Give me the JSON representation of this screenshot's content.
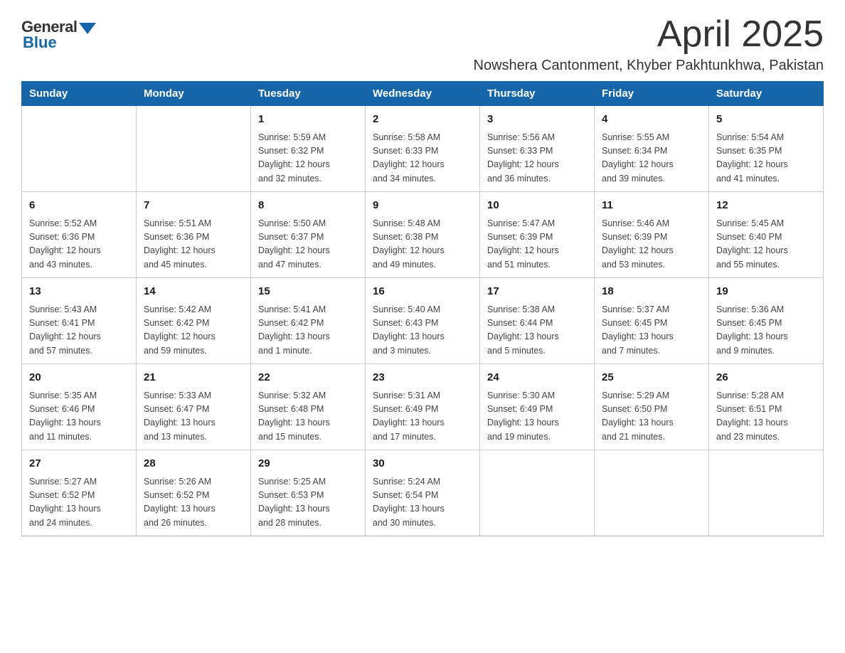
{
  "logo": {
    "general": "General",
    "blue": "Blue"
  },
  "title": "April 2025",
  "location": "Nowshera Cantonment, Khyber Pakhtunkhwa, Pakistan",
  "weekdays": [
    "Sunday",
    "Monday",
    "Tuesday",
    "Wednesday",
    "Thursday",
    "Friday",
    "Saturday"
  ],
  "weeks": [
    [
      {
        "day": "",
        "info": ""
      },
      {
        "day": "",
        "info": ""
      },
      {
        "day": "1",
        "info": "Sunrise: 5:59 AM\nSunset: 6:32 PM\nDaylight: 12 hours\nand 32 minutes."
      },
      {
        "day": "2",
        "info": "Sunrise: 5:58 AM\nSunset: 6:33 PM\nDaylight: 12 hours\nand 34 minutes."
      },
      {
        "day": "3",
        "info": "Sunrise: 5:56 AM\nSunset: 6:33 PM\nDaylight: 12 hours\nand 36 minutes."
      },
      {
        "day": "4",
        "info": "Sunrise: 5:55 AM\nSunset: 6:34 PM\nDaylight: 12 hours\nand 39 minutes."
      },
      {
        "day": "5",
        "info": "Sunrise: 5:54 AM\nSunset: 6:35 PM\nDaylight: 12 hours\nand 41 minutes."
      }
    ],
    [
      {
        "day": "6",
        "info": "Sunrise: 5:52 AM\nSunset: 6:36 PM\nDaylight: 12 hours\nand 43 minutes."
      },
      {
        "day": "7",
        "info": "Sunrise: 5:51 AM\nSunset: 6:36 PM\nDaylight: 12 hours\nand 45 minutes."
      },
      {
        "day": "8",
        "info": "Sunrise: 5:50 AM\nSunset: 6:37 PM\nDaylight: 12 hours\nand 47 minutes."
      },
      {
        "day": "9",
        "info": "Sunrise: 5:48 AM\nSunset: 6:38 PM\nDaylight: 12 hours\nand 49 minutes."
      },
      {
        "day": "10",
        "info": "Sunrise: 5:47 AM\nSunset: 6:39 PM\nDaylight: 12 hours\nand 51 minutes."
      },
      {
        "day": "11",
        "info": "Sunrise: 5:46 AM\nSunset: 6:39 PM\nDaylight: 12 hours\nand 53 minutes."
      },
      {
        "day": "12",
        "info": "Sunrise: 5:45 AM\nSunset: 6:40 PM\nDaylight: 12 hours\nand 55 minutes."
      }
    ],
    [
      {
        "day": "13",
        "info": "Sunrise: 5:43 AM\nSunset: 6:41 PM\nDaylight: 12 hours\nand 57 minutes."
      },
      {
        "day": "14",
        "info": "Sunrise: 5:42 AM\nSunset: 6:42 PM\nDaylight: 12 hours\nand 59 minutes."
      },
      {
        "day": "15",
        "info": "Sunrise: 5:41 AM\nSunset: 6:42 PM\nDaylight: 13 hours\nand 1 minute."
      },
      {
        "day": "16",
        "info": "Sunrise: 5:40 AM\nSunset: 6:43 PM\nDaylight: 13 hours\nand 3 minutes."
      },
      {
        "day": "17",
        "info": "Sunrise: 5:38 AM\nSunset: 6:44 PM\nDaylight: 13 hours\nand 5 minutes."
      },
      {
        "day": "18",
        "info": "Sunrise: 5:37 AM\nSunset: 6:45 PM\nDaylight: 13 hours\nand 7 minutes."
      },
      {
        "day": "19",
        "info": "Sunrise: 5:36 AM\nSunset: 6:45 PM\nDaylight: 13 hours\nand 9 minutes."
      }
    ],
    [
      {
        "day": "20",
        "info": "Sunrise: 5:35 AM\nSunset: 6:46 PM\nDaylight: 13 hours\nand 11 minutes."
      },
      {
        "day": "21",
        "info": "Sunrise: 5:33 AM\nSunset: 6:47 PM\nDaylight: 13 hours\nand 13 minutes."
      },
      {
        "day": "22",
        "info": "Sunrise: 5:32 AM\nSunset: 6:48 PM\nDaylight: 13 hours\nand 15 minutes."
      },
      {
        "day": "23",
        "info": "Sunrise: 5:31 AM\nSunset: 6:49 PM\nDaylight: 13 hours\nand 17 minutes."
      },
      {
        "day": "24",
        "info": "Sunrise: 5:30 AM\nSunset: 6:49 PM\nDaylight: 13 hours\nand 19 minutes."
      },
      {
        "day": "25",
        "info": "Sunrise: 5:29 AM\nSunset: 6:50 PM\nDaylight: 13 hours\nand 21 minutes."
      },
      {
        "day": "26",
        "info": "Sunrise: 5:28 AM\nSunset: 6:51 PM\nDaylight: 13 hours\nand 23 minutes."
      }
    ],
    [
      {
        "day": "27",
        "info": "Sunrise: 5:27 AM\nSunset: 6:52 PM\nDaylight: 13 hours\nand 24 minutes."
      },
      {
        "day": "28",
        "info": "Sunrise: 5:26 AM\nSunset: 6:52 PM\nDaylight: 13 hours\nand 26 minutes."
      },
      {
        "day": "29",
        "info": "Sunrise: 5:25 AM\nSunset: 6:53 PM\nDaylight: 13 hours\nand 28 minutes."
      },
      {
        "day": "30",
        "info": "Sunrise: 5:24 AM\nSunset: 6:54 PM\nDaylight: 13 hours\nand 30 minutes."
      },
      {
        "day": "",
        "info": ""
      },
      {
        "day": "",
        "info": ""
      },
      {
        "day": "",
        "info": ""
      }
    ]
  ]
}
